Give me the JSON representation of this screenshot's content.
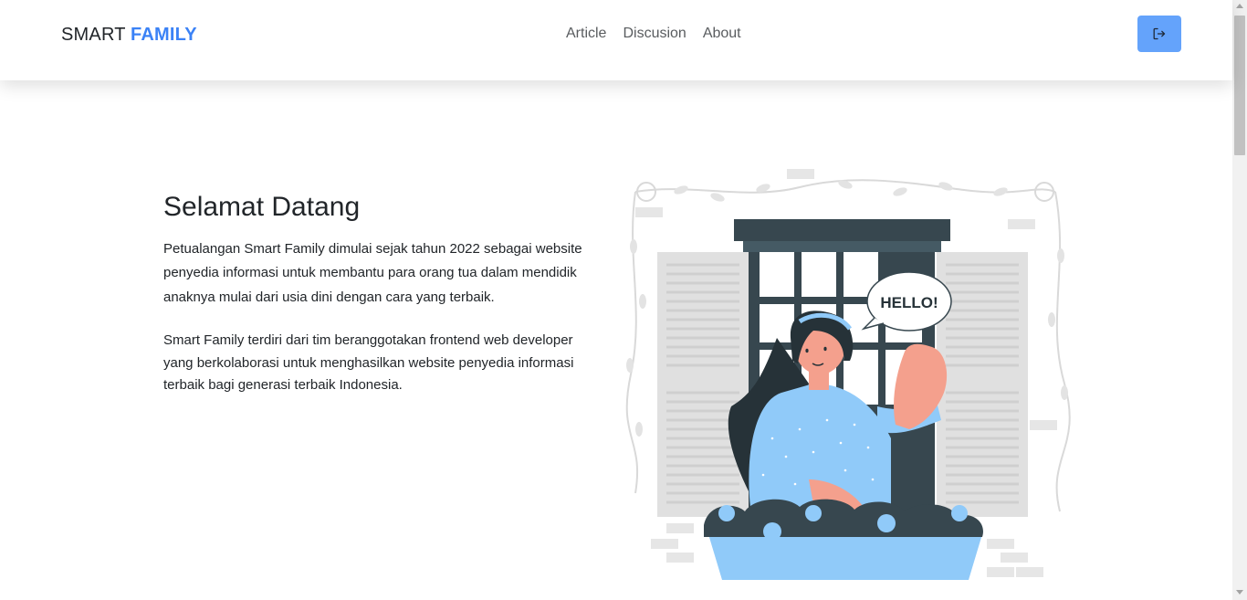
{
  "navbar": {
    "brand_part1": "SMART",
    "brand_part2": "FAMILY",
    "links": [
      "Article",
      "Discusion",
      "About"
    ],
    "logout_icon": "logout-icon"
  },
  "hero": {
    "title": "Selamat Datang",
    "paragraphs": [
      "Petualangan Smart Family dimulai sejak tahun 2022 sebagai website penyedia informasi untuk membantu para orang tua dalam mendidik anaknya mulai dari usia dini dengan cara yang terbaik.",
      "Smart Family terdiri dari tim beranggotakan frontend web developer yang berkolaborasi untuk menghasilkan website penyedia informasi terbaik bagi generasi terbaik Indonesia."
    ]
  },
  "illustration": {
    "speech_text": "HELLO!"
  },
  "colors": {
    "accent": "#3b82f6",
    "button": "#64a3fb",
    "window_frame": "#37474f",
    "sweater": "#90caf9",
    "skin": "#f4a08d"
  }
}
